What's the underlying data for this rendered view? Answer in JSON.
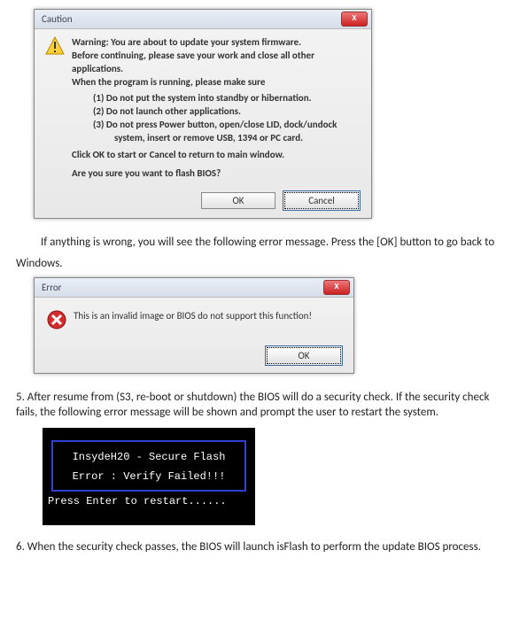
{
  "dialog1": {
    "title": "Caution",
    "close": "X",
    "lines": {
      "l1": "Warning: You are about to update your system firmware.",
      "l2": "Before continuing, please save your work and close all other applications.",
      "l3": "When the program is running, please make sure",
      "i1": "(1) Do not put the system into standby or hibernation.",
      "i2": "(2) Do not launch other applications.",
      "i3": "(3) Do not press Power button, open/close LID, dock/undock system, insert or remove USB, 1394 or PC card.",
      "l4": "Click OK to start or Cancel to return to main window.",
      "l5": "Are you sure you want to flash BIOS?"
    },
    "ok": "OK",
    "cancel": "Cancel"
  },
  "para1a": "If anything is wrong, you will see the following error message. Press the [OK] button to go back to",
  "para1b": "Windows.",
  "dialog2": {
    "title": "Error",
    "close": "X",
    "msg": "This is an invalid image or BIOS do not support this function!",
    "ok": "OK"
  },
  "list5": "5.    After resume from (S3, re-boot or shutdown) the BIOS will do a security check. If the security check fails, the following error message will be shown and prompt the user to restart the system.",
  "console": {
    "title": "InsydeH20 - Secure Flash",
    "error": "Error : Verify Failed!!!",
    "restart": "Press Enter to restart......"
  },
  "list6": "6.    When the security check passes, the BIOS will launch isFlash to perform the update BIOS process."
}
